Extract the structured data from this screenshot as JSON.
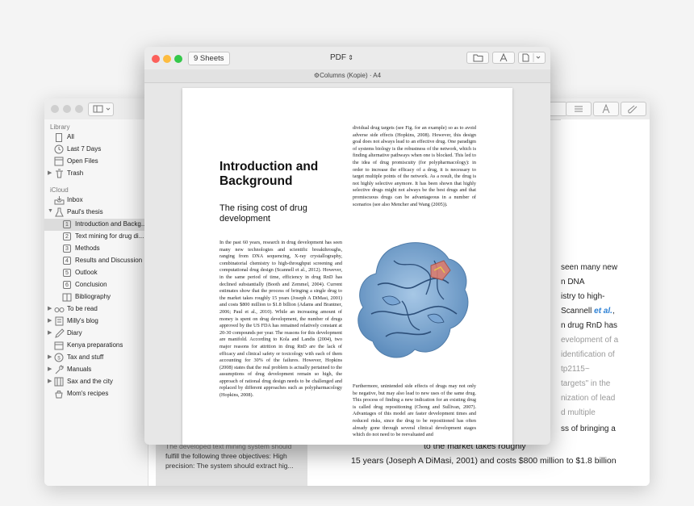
{
  "sidebar": {
    "library_header": "Library",
    "library_items": [
      {
        "label": "All",
        "icon": "document-icon"
      },
      {
        "label": "Last 7 Days",
        "icon": "clock-icon"
      },
      {
        "label": "Open Files",
        "icon": "open-files-icon"
      },
      {
        "label": "Trash",
        "icon": "trash-icon"
      }
    ],
    "icloud_header": "iCloud",
    "inbox": "Inbox",
    "project": "Paul's thesis",
    "sheets": [
      {
        "num": "1",
        "label": "Introduction and Backg..."
      },
      {
        "num": "2",
        "label": "Text mining for drug di..."
      },
      {
        "num": "3",
        "label": "Methods"
      },
      {
        "num": "4",
        "label": "Results and Discussion"
      },
      {
        "num": "5",
        "label": "Outlook"
      },
      {
        "num": "6",
        "label": "Conclusion"
      }
    ],
    "bibliography": "Bibliography",
    "groups": [
      {
        "label": "To be read",
        "icon": "glasses-icon"
      },
      {
        "label": "Milly's blog",
        "icon": "blog-icon"
      },
      {
        "label": "Diary",
        "icon": "pen-icon"
      },
      {
        "label": "Kenya preparations",
        "icon": "calendar-icon"
      },
      {
        "label": "Tax and stuff",
        "icon": "tax-icon"
      },
      {
        "label": "Manuals",
        "icon": "wrench-icon"
      },
      {
        "label": "Sax and the city",
        "icon": "keyboard-icon"
      },
      {
        "label": "Mom's recipes",
        "icon": "recipes-icon"
      }
    ]
  },
  "back_editor": {
    "right_lines": [
      "seen many new",
      "n DNA",
      "istry to high-",
      "Scannell",
      "n drug RnD has",
      "evelopment of a",
      "identification of",
      "tp2115~",
      "targets\" in the",
      "nization of lead",
      "d multiple",
      "ss of bringing a"
    ],
    "cite_et_al": "et al.",
    "bottom_note_lines": [
      "The developed text mining system should",
      "fulfill the following three objectives: High",
      "precision: The system should extract hig..."
    ],
    "bottom_big_lines": [
      "to the market takes roughly",
      "15 years (Joseph A DiMasi, 2001) and costs $800 million to $1.8 billion"
    ]
  },
  "print_window": {
    "sheets_button": "9 Sheets",
    "format": "PDF",
    "template": "Columns (Kopie) · A4"
  },
  "document": {
    "title": "Introduction and Background",
    "subtitle": "The rising cost of drug development",
    "col1": "In the past 60 years, research in drug development has seen many new technologies and scientific breakthroughs, ranging from DNA sequencing, X-ray crystallography, combinatorial chemistry to high-throughput screening and computational drug design (Scannell et al., 2012). However, in the same period of time, efficiency in drug RnD has declined substantially (Booth and Zemmel, 2004). Current estimates show that the process of bringing a single drug to the market takes roughly 15 years (Joseph A DiMasi, 2001) and costs $800 million to $1.8 billion (Adams and Brantner, 2006; Paul et al., 2010). While an increasing amount of money is spent on drug development, the number of drugs approved by the US FDA has remained relatively constant at 20-30 compounds per year. The reasons for this development are manifold. According to Kola and Landis (2004), two major reasons for attrition in drug RnD are the lack of efficacy and clinical safety or toxicology with each of them accounting for 30% of the failures. However, Hopkins (2008) states that the real problem is actually pertained to the assumptions of drug development remain so high, the approach of rational drug design needs to be challenged and replaced by different approaches such as polypharmacology (Hopkins, 2008).",
    "col2_top": "dividual drug targets (see Fig. for an example) so as to avoid adverse side effects (Hopkins, 2008). However, this design goal does not always lead to an effective drug. One paradigm of systems biology is the robustness of the network, which is finding alternative pathways when one is blocked. This led to the idea of drug promiscuity (for polypharmacology): in order to increase the efficacy of a drug, it is necessary to target multiple points of the network. As a result, the drug is not highly selective anymore. It has been shown that highly selective drugs might not always be the best drugs and that promiscuous drugs can be advantageous in a number of scenarios (see also Mencher and Wang (2005)).",
    "col2_bottom": "Furthermore, unintended side effects of drugs may not only be negative, but may also lead to new uses of the same drug. This process of finding a new indication for an existing drug is called drug repositioning (Chong and Sullivan, 2007). Advantages of this model are faster development times and reduced risks, since the drug to be repositioned has often already gone through several clinical development stages which do not need to be reevaluated and"
  },
  "colors": {
    "close": "#fc605b",
    "minimize": "#fdbc40",
    "zoom": "#34c84a",
    "citation_blue": "#2a7fd4",
    "selected_row": "#dcdcdc"
  }
}
